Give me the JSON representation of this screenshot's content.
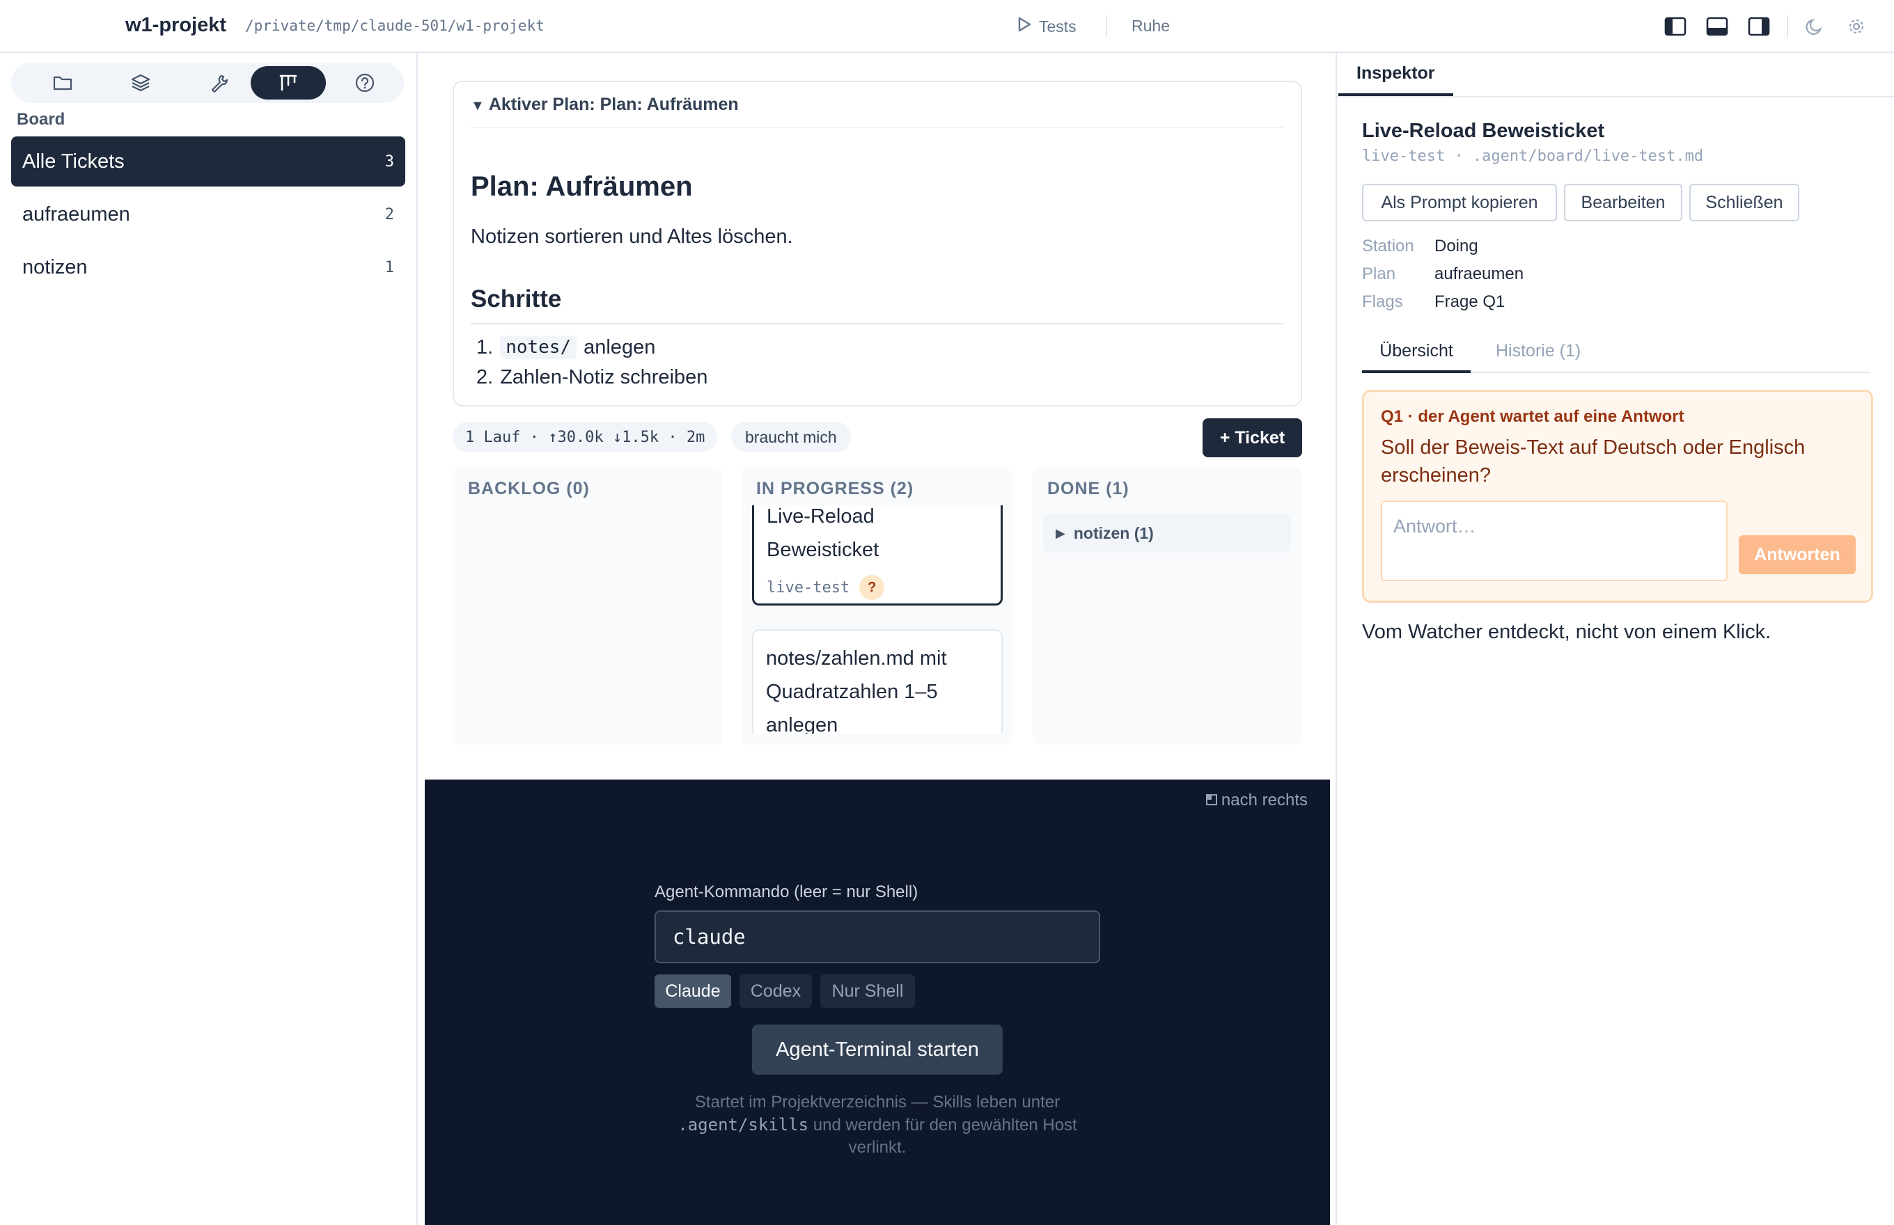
{
  "topbar": {
    "title": "w1-projekt",
    "path": "/private/tmp/claude-501/w1-projekt",
    "tests_label": "Tests",
    "status": "Ruhe",
    "icons": [
      "sidebar-left-icon",
      "panel-bottom-icon",
      "sidebar-right-icon",
      "moon-icon",
      "gear-icon"
    ]
  },
  "sidebar": {
    "nav_icons": [
      "folder-icon",
      "layers-icon",
      "wrench-icon",
      "kanban-icon",
      "help-icon"
    ],
    "active_nav": "kanban-icon",
    "section_label": "Board",
    "items": [
      {
        "label": "Alle Tickets",
        "count": "3",
        "active": true
      },
      {
        "label": "aufraeumen",
        "count": "2",
        "active": false
      },
      {
        "label": "notizen",
        "count": "1",
        "active": false
      }
    ]
  },
  "plan": {
    "summary": "Aktiver Plan: Plan: Aufräumen",
    "title": "Plan: Aufräumen",
    "description": "Notizen sortieren und Altes löschen.",
    "steps_title": "Schritte",
    "steps": [
      {
        "num": "1.",
        "code": "notes/",
        "text": "anlegen"
      },
      {
        "num": "2.",
        "code": "",
        "text": "Zahlen-Notiz schreiben"
      }
    ]
  },
  "board": {
    "stats": "1 Lauf · ↑30.0k ↓1.5k · 2m",
    "needs_me": "braucht mich",
    "add_ticket": "+ Ticket",
    "columns": [
      {
        "title": "BACKLOG (0)",
        "tickets": []
      },
      {
        "title": "IN PROGRESS (2)",
        "tickets": [
          {
            "title": "Live-Reload Beweisticket",
            "slug": "live-test",
            "flag": "?",
            "selected": true
          },
          {
            "title": "notes/zahlen.md mit Quadratzahlen 1–5 anlegen",
            "selected": false
          }
        ]
      },
      {
        "title": "DONE (1)",
        "groups": [
          {
            "label": "notizen (1)",
            "collapsed": true
          }
        ]
      }
    ]
  },
  "terminal": {
    "dock_label": "nach rechts",
    "cmd_label": "Agent-Kommando (leer = nur Shell)",
    "cmd_value": "claude",
    "hosts": [
      {
        "label": "Claude",
        "active": true
      },
      {
        "label": "Codex",
        "active": false
      },
      {
        "label": "Nur Shell",
        "active": false
      }
    ],
    "start_label": "Agent-Terminal starten",
    "note_pre": "Startet im Projektverzeichnis — Skills leben unter",
    "note_code": ".agent/skills",
    "note_post": "und werden für den gewählten Host verlinkt."
  },
  "inspector": {
    "tab": "Inspektor",
    "ticket_title": "Live-Reload Beweisticket",
    "ticket_meta": "live-test · .agent/board/live-test.md",
    "actions": [
      "Als Prompt kopieren",
      "Bearbeiten",
      "Schließen"
    ],
    "fields": [
      {
        "key": "Station",
        "value": "Doing"
      },
      {
        "key": "Plan",
        "value": "aufraeumen"
      },
      {
        "key": "Flags",
        "value": "Frage Q1"
      }
    ],
    "sub_tabs": [
      "Übersicht",
      "Historie (1)"
    ],
    "question": {
      "head": "Q1 · der Agent wartet auf eine Antwort",
      "text": "Soll der Beweis-Text auf Deutsch oder Englisch erscheinen?",
      "placeholder": "Antwort…",
      "send": "Antworten"
    },
    "body": "Vom Watcher entdeckt, nicht von einem Klick."
  },
  "colors": {
    "primary": "#1e293b",
    "question_bg": "#fff7ed",
    "question_border": "#fcd9b4",
    "question_accent": "#9a3412",
    "send_button": "#fdba8c",
    "terminal_bg": "#0f172a"
  }
}
